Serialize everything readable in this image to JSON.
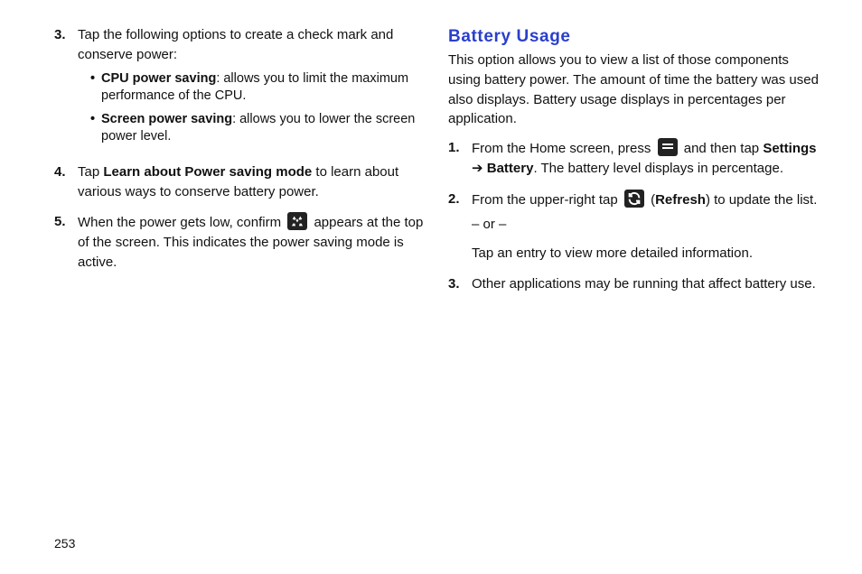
{
  "left": {
    "step3": {
      "num": "3.",
      "intro": "Tap the following options to create a check mark and conserve power:",
      "bullets": [
        {
          "bold": "CPU power saving",
          "rest": ": allows you to limit the maximum performance of the CPU."
        },
        {
          "bold": "Screen power saving",
          "rest": ": allows you to lower the screen power level."
        }
      ]
    },
    "step4": {
      "num": "4.",
      "pre": "Tap ",
      "bold": "Learn about Power saving mode",
      "post": " to learn about various ways to conserve battery power."
    },
    "step5": {
      "num": "5.",
      "pre": "When the power gets low, confirm ",
      "post": " appears at the top of the screen. This indicates the power saving mode is active."
    }
  },
  "right": {
    "heading": "Battery Usage",
    "intro": "This option allows you to view a list of those components using battery power. The amount of time the battery was used also displays. Battery usage displays in percentages per application.",
    "step1": {
      "num": "1.",
      "pre": "From the Home screen, press ",
      "mid": " and then tap ",
      "bold1": "Settings",
      "arrow": " ➔ ",
      "bold2": "Battery",
      "post": ". The battery level displays in percentage."
    },
    "step2": {
      "num": "2.",
      "pre": "From the upper-right tap ",
      "open_paren": " (",
      "refresh_bold": "Refresh",
      "close_paren": ") to update the list.",
      "or": "– or –",
      "tap_entry": "Tap an entry to view more detailed information."
    },
    "step3": {
      "num": "3.",
      "text": "Other applications may be running that affect battery use."
    }
  },
  "page_number": "253"
}
